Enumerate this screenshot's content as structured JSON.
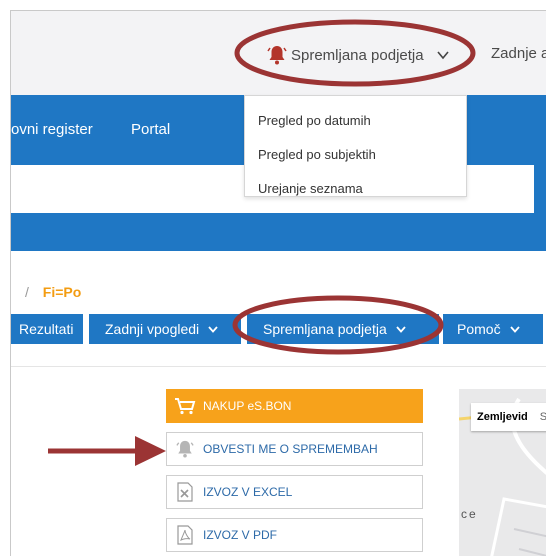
{
  "header": {
    "watched_label": "Spremljana podjetja",
    "recent_label": "Zadnje a"
  },
  "watched_menu": {
    "items": [
      "Pregled po datumih",
      "Pregled po subjektih",
      "Urejanje seznama"
    ]
  },
  "nav": {
    "items": [
      "ovni register",
      "Portal"
    ]
  },
  "breadcrumb": {
    "separator": "/",
    "current": "Fi=Po"
  },
  "tabs": {
    "items": [
      "Rezultati",
      "Zadnji vpogledi",
      "Spremljana podjetja",
      "Pomoč"
    ]
  },
  "actions": {
    "buy": "NAKUP eS.BON",
    "notify": "OBVESTI ME O SPREMEMBAH",
    "excel": "IZVOZ V EXCEL",
    "pdf": "IZVOZ V PDF"
  },
  "map": {
    "type_options": [
      "Zemljevid",
      "S"
    ],
    "label": "ce"
  },
  "colors": {
    "brand_blue": "#1f77c4",
    "buy_orange": "#f7a21b",
    "breadcrumb_orange": "#f39c12",
    "annotation_red": "#9b3434",
    "bell_red": "#b3352b"
  }
}
